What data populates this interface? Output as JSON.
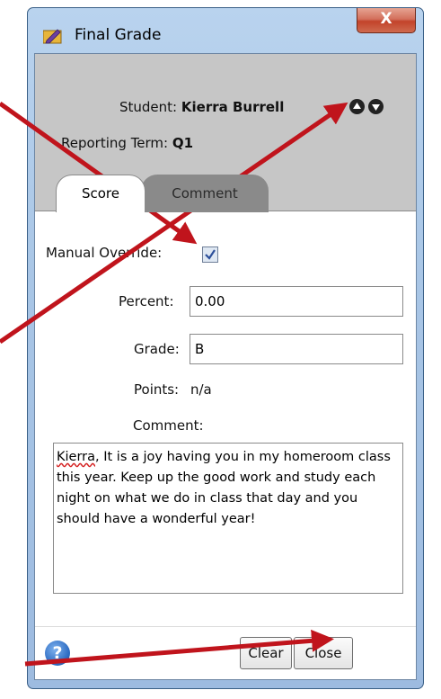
{
  "window": {
    "title": "Final Grade",
    "close_glyph": "X",
    "title_icon": "folder-pencil-icon"
  },
  "header": {
    "student_label": "Student:",
    "student_name": "Kierra Burrell",
    "term_label": "Reporting Term:",
    "term_value": "Q1"
  },
  "tabs": [
    {
      "label": "Score",
      "selected": true
    },
    {
      "label": "Comment",
      "selected": false
    }
  ],
  "form": {
    "manual_override_label": "Manual Override:",
    "manual_override_checked": true,
    "percent_label": "Percent:",
    "percent_value": "0.00",
    "grade_label": "Grade:",
    "grade_value": "B",
    "points_label": "Points:",
    "points_value": "n/a",
    "comment_label": "Comment:",
    "comment_first_word": "Kierra",
    "comment_rest": ", It is a joy having you in my homeroom class this year.  Keep up the good work and study each night on what we do in class that day and you should have a wonderful year!"
  },
  "footer": {
    "help_glyph": "?",
    "clear_label": "Clear",
    "close_label": "Close"
  },
  "colors": {
    "annotation_arrow": "#c0141c",
    "header_bg": "#c6c6c6",
    "inactive_tab_bg": "#8a8a8a"
  }
}
